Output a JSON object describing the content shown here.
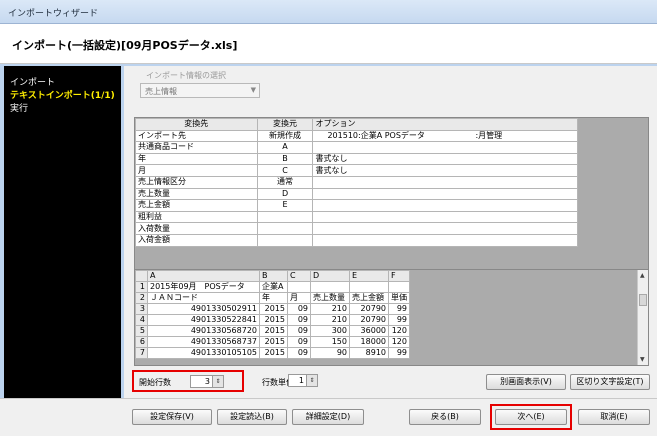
{
  "window": {
    "title": "インポートウィザード"
  },
  "header": {
    "title": "インポート(一括設定)[09月POSデータ.xls]"
  },
  "sidebar": {
    "items": [
      {
        "label": "インポート"
      },
      {
        "label": "テキストインポート(1/1)"
      },
      {
        "label": "実行"
      }
    ]
  },
  "selector": {
    "label": "インポート情報の選択",
    "value": "売上情報"
  },
  "mapping": {
    "headers": [
      "変換先",
      "変換元",
      "オプション"
    ],
    "rows": [
      {
        "dest": "インポート先",
        "src": "新規作成",
        "opt": "201510:企業A POSデータ",
        "opt2": ":月管理"
      },
      {
        "dest": "共通商品コード",
        "src": "A",
        "opt": "",
        "opt2": ""
      },
      {
        "dest": "年",
        "src": "B",
        "opt": "書式なし",
        "opt2": ""
      },
      {
        "dest": "月",
        "src": "C",
        "opt": "書式なし",
        "opt2": ""
      },
      {
        "dest": "売上情報区分",
        "src": "通常",
        "opt": "",
        "opt2": ""
      },
      {
        "dest": "売上数量",
        "src": "D",
        "opt": "",
        "opt2": ""
      },
      {
        "dest": "売上金額",
        "src": "E",
        "opt": "",
        "opt2": ""
      },
      {
        "dest": "粗利益",
        "src": "",
        "opt": "",
        "opt2": ""
      },
      {
        "dest": "入荷数量",
        "src": "",
        "opt": "",
        "opt2": ""
      },
      {
        "dest": "入荷金額",
        "src": "",
        "opt": "",
        "opt2": ""
      }
    ]
  },
  "preview": {
    "columns": [
      "A",
      "B",
      "C",
      "D",
      "E",
      "F"
    ],
    "rows": [
      {
        "n": "1",
        "cells": [
          "2015年09月　POSデータ",
          "企業A",
          "",
          "",
          "",
          ""
        ]
      },
      {
        "n": "2",
        "cells": [
          "ＪＡＮコード",
          "年",
          "月",
          "売上数量",
          "売上金額",
          "単価"
        ]
      },
      {
        "n": "3",
        "cells": [
          "4901330502911",
          "2015",
          "09",
          "210",
          "20790",
          "99"
        ]
      },
      {
        "n": "4",
        "cells": [
          "4901330522841",
          "2015",
          "09",
          "210",
          "20790",
          "99"
        ]
      },
      {
        "n": "5",
        "cells": [
          "4901330568720",
          "2015",
          "09",
          "300",
          "36000",
          "120"
        ]
      },
      {
        "n": "6",
        "cells": [
          "4901330568737",
          "2015",
          "09",
          "150",
          "18000",
          "120"
        ]
      },
      {
        "n": "7",
        "cells": [
          "4901330105105",
          "2015",
          "09",
          "90",
          "8910",
          "99"
        ]
      }
    ]
  },
  "controls": {
    "start_row_label": "開始行数",
    "start_row_value": "3",
    "line_unit_label": "行数単位",
    "line_unit_value": "1",
    "separate_window": "別画面表示(V)",
    "delimiter_setting": "区切り文字設定(T)"
  },
  "buttons": {
    "save_settings": "設定保存(V)",
    "load_settings": "設定読込(B)",
    "detail_settings": "詳細設定(D)",
    "back": "戻る(B)",
    "next": "次へ(E)",
    "cancel": "取消(E)"
  },
  "colors": {
    "highlight_border": "#e60000",
    "sidebar_bg": "#000000",
    "active_item": "#ffee00"
  }
}
